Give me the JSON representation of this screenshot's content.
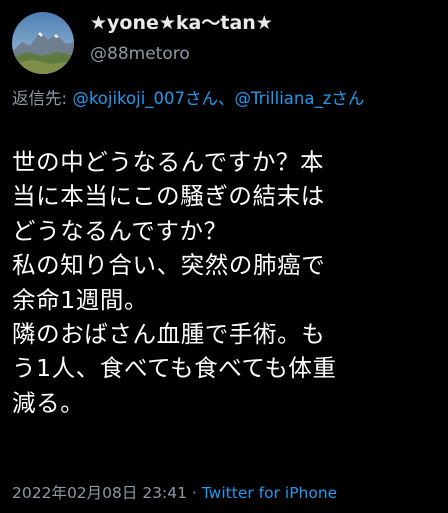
{
  "user": {
    "display_name": "★yone★ka〜tan★",
    "handle": "@88metoro"
  },
  "reply": {
    "prefix": "返信先: ",
    "mention_1": "@kojikoji_007さん",
    "separator": "、",
    "mention_2": "@Trilliana_zさん"
  },
  "tweet": {
    "lines": [
      "世の中どうなるんですか？本",
      "当に本当にこの騒ぎの結末は",
      "どうなるんですか？",
      "私の知り合い、突然の肺癌で",
      "余命1週間。",
      "隣のおばさん血腫で手術。も",
      "う1人、食べても食べても体重",
      "減る。"
    ]
  },
  "meta": {
    "timestamp": "2022年02月08日 23:41",
    "separator": " · ",
    "source": "Twitter for iPhone"
  },
  "icons": {
    "avatar": "mountain-landscape-avatar",
    "more": "more-options-icon"
  },
  "colors": {
    "background": "#000000",
    "text": "#ffffff",
    "secondary": "#8b98a5",
    "link": "#1d9bf0"
  }
}
